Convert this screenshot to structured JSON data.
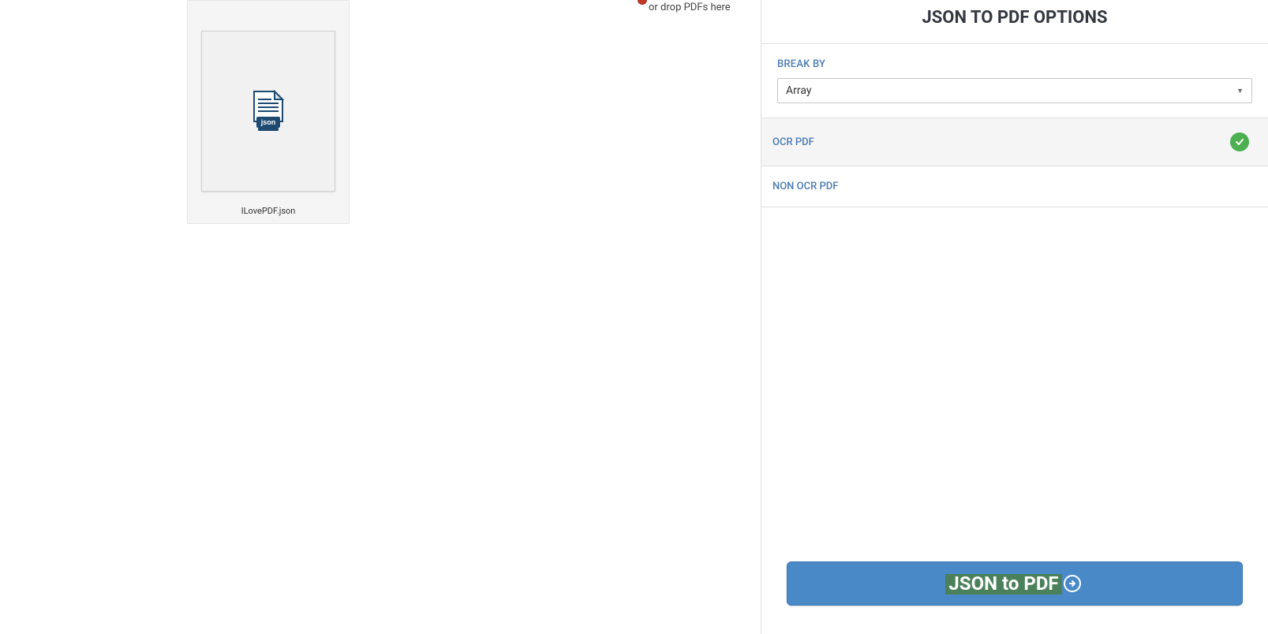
{
  "file": {
    "name": "ILovePDF.json",
    "icon_label": "json"
  },
  "drop_text": "or drop PDFs here",
  "sidebar": {
    "title": "JSON TO PDF OPTIONS",
    "break_by_label": "BREAK BY",
    "break_by_value": "Array",
    "option_ocr": "OCR PDF",
    "option_nonocr": "NON OCR PDF",
    "convert_label": "JSON to PDF"
  }
}
